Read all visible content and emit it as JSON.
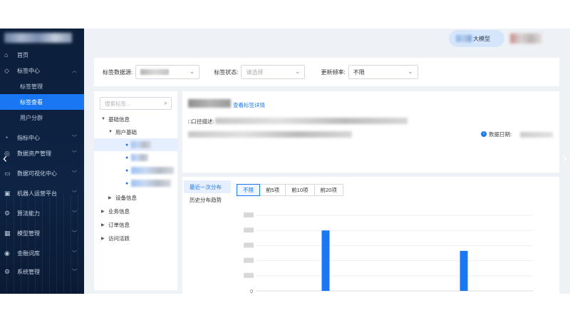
{
  "sidebar": {
    "items": [
      {
        "label": "首页",
        "icon": "home-icon"
      },
      {
        "label": "标签中心",
        "icon": "tag-icon",
        "expanded": true,
        "children": [
          {
            "label": "标签管理"
          },
          {
            "label": "标签查看",
            "active": true
          },
          {
            "label": "用户分群"
          }
        ]
      },
      {
        "label": "指标中心",
        "icon": "metric-icon"
      },
      {
        "label": "数据资产管理",
        "icon": "asset-icon"
      },
      {
        "label": "数据可视化中心",
        "icon": "monitor-icon"
      },
      {
        "label": "机器人运营平台",
        "icon": "robot-icon"
      },
      {
        "label": "算法能力",
        "icon": "algorithm-icon"
      },
      {
        "label": "模型管理",
        "icon": "grid-icon"
      },
      {
        "label": "金融词库",
        "icon": "database-icon"
      },
      {
        "label": "系统管理",
        "icon": "gear-icon"
      }
    ]
  },
  "topbar": {
    "model_label": "大模型"
  },
  "filters": {
    "source_label": "标签数据源:",
    "status_label": "标签状态:",
    "status_placeholder": "请选择",
    "freq_label": "更新频率:",
    "freq_value": "不限"
  },
  "tree": {
    "search_placeholder": "搜索标签...",
    "nodes": {
      "basic": "基础信息",
      "user_basic": "用户基础",
      "device": "设备信息",
      "business": "业务信息",
      "order": "订单信息",
      "visit": "访问活跃"
    }
  },
  "info": {
    "detail_link": "查看标签详情",
    "desc_label": "口径描述:",
    "date_label": "数据日期:"
  },
  "chart_tabs": {
    "recent": "最近一次分布",
    "history": "历史分布趋势"
  },
  "segments": [
    "不限",
    "前5项",
    "前10项",
    "前20项"
  ],
  "chart_data": {
    "type": "bar",
    "categories": [
      "",
      ""
    ],
    "values": [
      80,
      53
    ],
    "ylim": [
      0,
      100
    ],
    "yticks": [
      "0"
    ],
    "grid": true,
    "bar_color": "#1977f3"
  }
}
